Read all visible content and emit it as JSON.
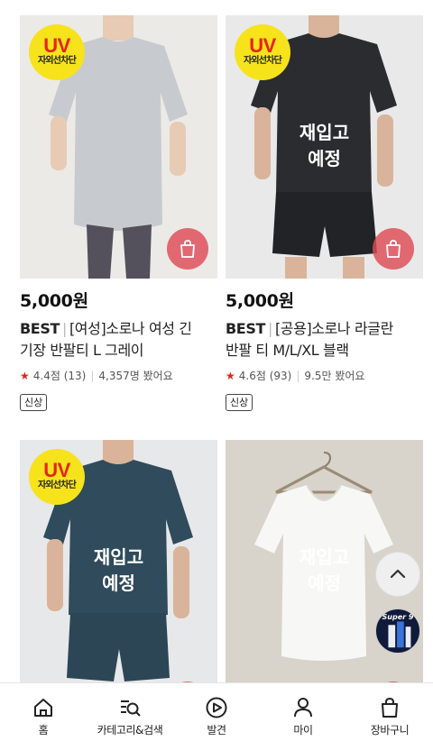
{
  "products": [
    {
      "price": "5,000원",
      "best": "BEST",
      "title_line1": "[여성]소로나 여성 긴",
      "title_line2": "기장 반팔티 L 그레이",
      "rating": "4.4점 (13)",
      "views": "4,357명 봤어요",
      "tag": "신상",
      "uv_badge": {
        "uv": "UV",
        "text": "자외선차단"
      },
      "restock": null
    },
    {
      "price": "5,000원",
      "best": "BEST",
      "title_line1": "[공용]소로나 라글란",
      "title_line2": "반팔 티 M/L/XL 블랙",
      "rating": "4.6점 (93)",
      "views": "9.5만 봤어요",
      "tag": "신상",
      "uv_badge": {
        "uv": "UV",
        "text": "자외선차단"
      },
      "restock": {
        "line1": "재입고",
        "line2": "예정"
      }
    },
    {
      "uv_badge": {
        "uv": "UV",
        "text": "자외선차단"
      },
      "restock": {
        "line1": "재입고",
        "line2": "예정"
      }
    },
    {
      "uv_badge": null,
      "restock": {
        "line1": "재입고",
        "line2": "예정"
      }
    }
  ],
  "floating": {
    "scroll_top_icon": "chevron-up-icon",
    "promo_text": "Super 9"
  },
  "bottom_nav": [
    {
      "label": "홈",
      "icon": "home-icon"
    },
    {
      "label": "카테고리&검색",
      "icon": "category-search-icon"
    },
    {
      "label": "발견",
      "icon": "discover-icon"
    },
    {
      "label": "마이",
      "icon": "profile-icon"
    },
    {
      "label": "장바구니",
      "icon": "shopping-bag-icon"
    }
  ],
  "colors": {
    "accent_red": "#e5241d",
    "cart_button": "#de4c56",
    "uv_yellow": "#f7e31b"
  }
}
